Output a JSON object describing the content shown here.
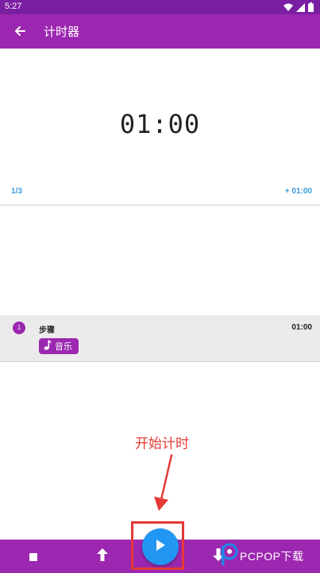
{
  "status_bar": {
    "time": "5:27",
    "icons": [
      "wifi-icon",
      "cellular-icon",
      "battery-icon"
    ]
  },
  "app_bar": {
    "title": "计时器",
    "back_icon": "arrow-back-icon"
  },
  "timer": {
    "display": "01:00",
    "step_counter": "1/3",
    "add_time_label": "+ 01:00"
  },
  "steps": [
    {
      "number": "1",
      "name": "步骤",
      "duration": "01:00",
      "chip_label": "音乐",
      "chip_icon": "music-note-icon"
    }
  ],
  "annotation": {
    "text": "开始计时"
  },
  "bottom_bar": {
    "buttons": [
      "stop-icon",
      "move-up-icon",
      "play-icon",
      "move-down-icon"
    ]
  },
  "watermark": {
    "text": "PCPOP下载"
  },
  "colors": {
    "primary": "#9c27b0",
    "primary_dark": "#7b1fa2",
    "accent_blue": "#2196f3",
    "link_blue": "#3a9bd8",
    "annotation_red": "#e53935"
  }
}
